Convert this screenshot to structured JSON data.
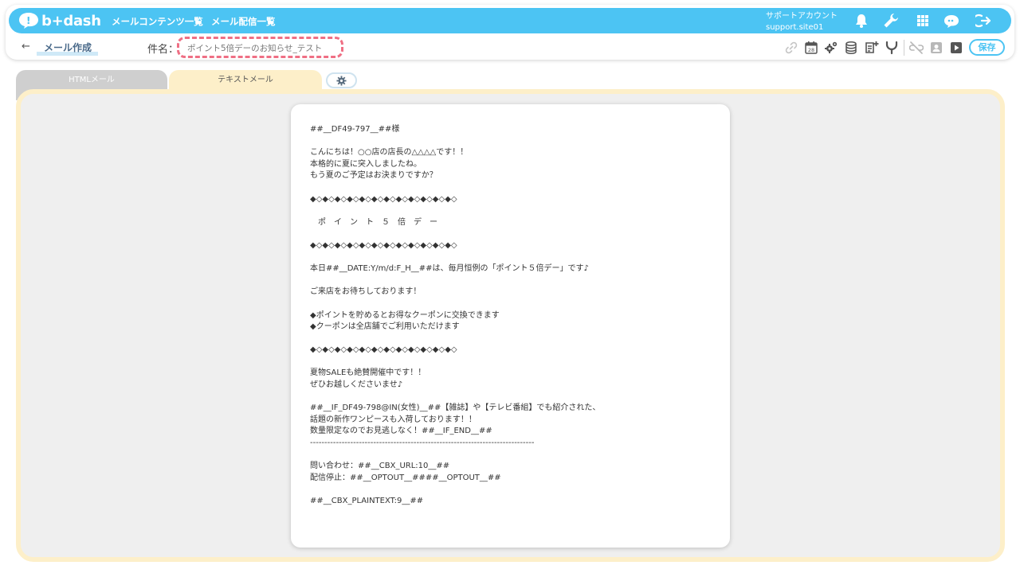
{
  "app": {
    "logo_text": "b+dash",
    "nav": [
      {
        "label": "メールコンテンツ一覧"
      },
      {
        "label": "メール配信一覧"
      }
    ],
    "account": {
      "line1": "サポートアカウント",
      "line2": "support.site01"
    },
    "top_icons": [
      "bell-icon",
      "wrench-icon",
      "grid-icon",
      "chat-icon",
      "logout-icon"
    ],
    "brand_color": "#4cc4f3"
  },
  "toolbar": {
    "back_symbol": "←",
    "page_title": "メール作成",
    "subject_label": "件名：",
    "subject_value": "ポイント5倍デーのお知らせ_テスト",
    "tool_icons": [
      "link-icon",
      "calendar-icon",
      "gears-icon",
      "database-icon",
      "add-document-icon",
      "merge-icon",
      "unlink-icon",
      "contact-card-icon",
      "play-icon"
    ],
    "calendar_day": "28",
    "save_label": "保存"
  },
  "tabs": [
    {
      "label": "HTMLメール",
      "active": false
    },
    {
      "label": "テキストメール",
      "active": true
    }
  ],
  "settings_icon": "gear-icon",
  "document": {
    "lines": [
      "##__DF49-797__##様",
      "",
      "こんにちは！○○店の店長の△△△△です！！",
      "本格的に夏に突入しましたね。",
      "もう夏のご予定はお決まりですか？",
      "",
      "◆◇◆◇◆◇◆◇◆◇◆◇◆◇◆◇◆◇◆◇◆◇◆◇",
      "",
      "　ポ　イ　ン　ト　５　倍　デ　ー",
      "",
      "◆◇◆◇◆◇◆◇◆◇◆◇◆◇◆◇◆◇◆◇◆◇◆◇",
      "",
      "本日##__DATE:Y/m/d:F_H__##は、毎月恒例の「ポイント５倍デー」です♪",
      "",
      "ご来店をお待ちしております！",
      "",
      "◆ポイントを貯めるとお得なクーポンに交換できます",
      "◆クーポンは全店舗でご利用いただけます",
      "",
      "◆◇◆◇◆◇◆◇◆◇◆◇◆◇◆◇◆◇◆◇◆◇◆◇",
      "",
      "夏物SALEも絶賛開催中です！！",
      "ぜひお越しくださいませ♪",
      "",
      "##__IF_DF49-798@IN(女性)__##【雑誌】や【テレビ番組】でも紹介された、",
      "話題の新作ワンピースも入荷しております！！",
      "数量限定なのでお見逃しなく！##__IF_END__##",
      "------------------------------------------------------------------------------",
      "",
      "問い合わせ：##__CBX_URL:10__##",
      "配信停止：##__OPTOUT__####__OPTOUT__##",
      "",
      "##__CBX_PLAINTEXT:9__##"
    ]
  }
}
